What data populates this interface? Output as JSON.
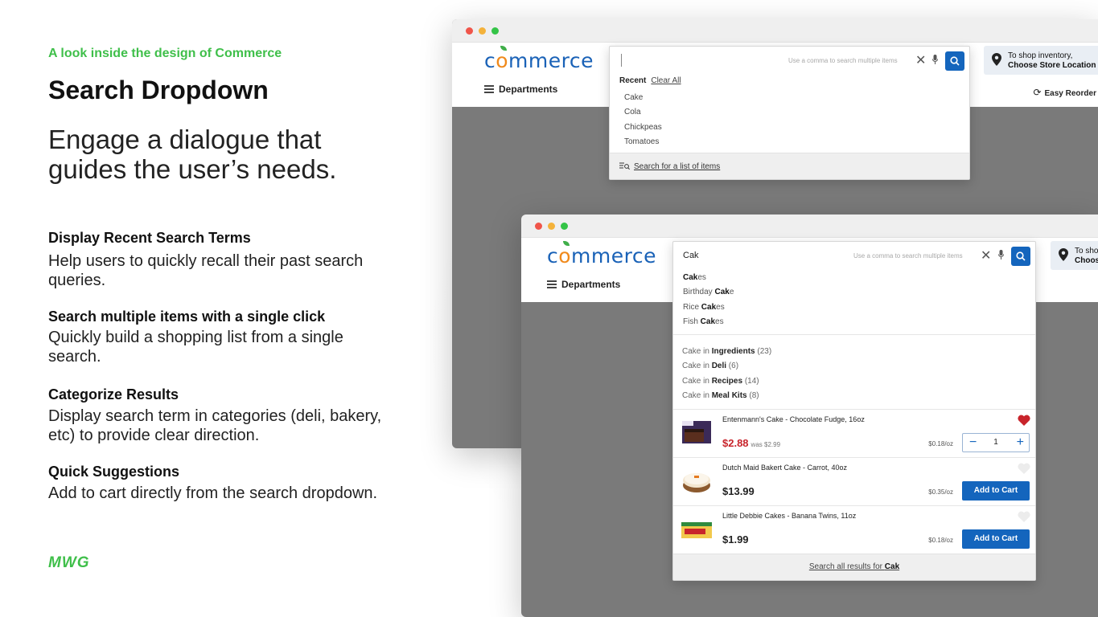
{
  "intro": {
    "eyebrow": "A look inside the design of Commerce",
    "title": "Search Dropdown",
    "tagline": "Engage a dialogue that guides the user’s needs."
  },
  "features": [
    {
      "heading": "Display Recent Search Terms",
      "body": "Help users to quickly recall their past search queries."
    },
    {
      "heading": "Search multiple items with a single click",
      "body": "Quickly build a shopping list from a single search."
    },
    {
      "heading": "Categorize Results",
      "body": "Display search term in categories (deli, bakery, etc) to provide clear direction."
    },
    {
      "heading": "Quick Suggestions",
      "body": "Add to cart directly from the search dropdown."
    }
  ],
  "brand": "MWG",
  "site": {
    "logo_left": "c",
    "logo_o": "o",
    "logo_right": "mmerce",
    "departments": "Departments",
    "store_line1": "To shop inventory,",
    "store_line2": "Choose Store Location",
    "store_line1_short": "To sho",
    "store_line2_short": "Choos",
    "reorder": "Easy Reorder"
  },
  "search1": {
    "hint": "Use a comma to search multiple items",
    "recent_label": "Recent",
    "clear_all": "Clear All",
    "recent": [
      "Cake",
      "Cola",
      "Chickpeas",
      "Tomatoes"
    ],
    "list_link": "Search for a list of items"
  },
  "search2": {
    "query": "Cak",
    "hint": "Use a comma to search multiple items",
    "suggestions": [
      {
        "pre": "",
        "bold": "Cak",
        "post": "es"
      },
      {
        "pre": "Birthday ",
        "bold": "Cak",
        "post": "e"
      },
      {
        "pre": "Rice ",
        "bold": "Cak",
        "post": "es"
      },
      {
        "pre": "Fish ",
        "bold": "Cak",
        "post": "es"
      }
    ],
    "categories": [
      {
        "term": "Cake in ",
        "cat": "Ingredients",
        "count": " (23)"
      },
      {
        "term": "Cake in ",
        "cat": "Deli",
        "count": " (6)"
      },
      {
        "term": "Cake in ",
        "cat": "Recipes",
        "count": " (14)"
      },
      {
        "term": "Cake in ",
        "cat": "Meal Kits",
        "count": " (8)"
      }
    ],
    "products": [
      {
        "name": "Entenmann's Cake - Chocolate Fudge, 16oz",
        "price": "$2.88",
        "was": "was $2.99",
        "unit": "$0.18/oz",
        "qty": "1",
        "favorited": true
      },
      {
        "name": "Dutch Maid Bakert Cake - Carrot, 40oz",
        "price": "$13.99",
        "unit": "$0.35/oz",
        "add": "Add to Cart",
        "favorited": false
      },
      {
        "name": "Little Debbie Cakes - Banana Twins, 11oz",
        "price": "$1.99",
        "unit": "$0.18/oz",
        "add": "Add to Cart",
        "favorited": false
      }
    ],
    "all_results_prefix": "Search all results for ",
    "all_results_term": "Cak"
  },
  "colors": {
    "accent_green": "#3fbf4a",
    "primary_blue": "#1465bd",
    "sale_red": "#c8242b",
    "logo_orange": "#f08a1c"
  },
  "icons": [
    "hamburger-icon",
    "location-pin-icon",
    "reorder-icon",
    "clear-icon",
    "microphone-icon",
    "search-icon",
    "list-search-icon",
    "heart-icon",
    "minus-icon",
    "plus-icon"
  ]
}
